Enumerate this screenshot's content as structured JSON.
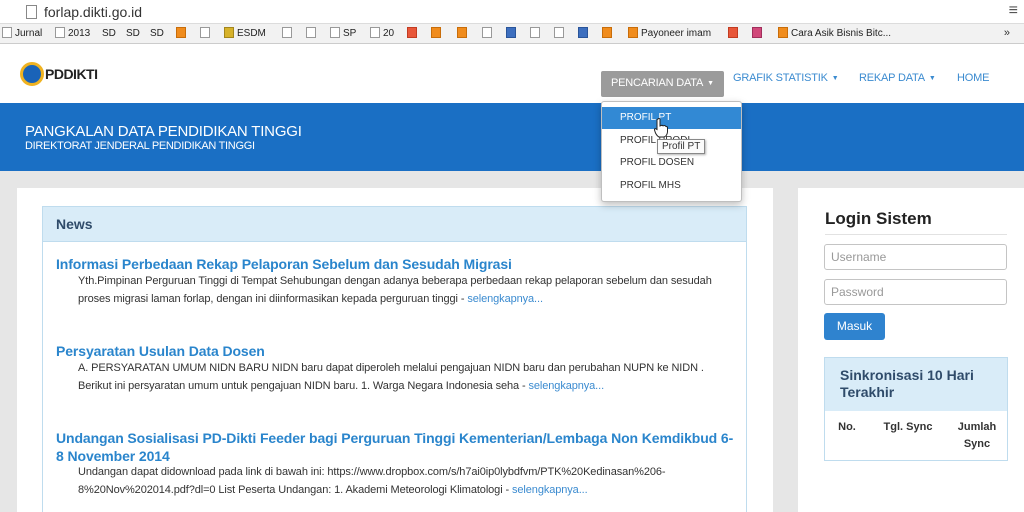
{
  "browser": {
    "url": "forlap.dikti.go.id",
    "bookmarks": [
      "Jurnal",
      "2013",
      "SD",
      "SD",
      "SD",
      "ESDM",
      "SP",
      "20",
      "Payoneer imam",
      "Cara Asik Bisnis Bitc..."
    ],
    "overflow": "»"
  },
  "site": {
    "logo_text": "PDDIKTI",
    "nav": [
      {
        "label": "PENCARIAN DATA"
      },
      {
        "label": "GRAFIK STATISTIK"
      },
      {
        "label": "REKAP DATA"
      },
      {
        "label": "HOME"
      }
    ],
    "dropdown": [
      "PROFIL PT",
      "PROFIL PRODI",
      "PROFIL DOSEN",
      "PROFIL MHS"
    ],
    "tooltip": "Profil PT",
    "banner_title": "PANGKALAN DATA PENDIDIKAN TINGGI",
    "banner_subtitle": "DIREKTORAT JENDERAL PENDIDIKAN TINGGI"
  },
  "news": {
    "heading": "News",
    "items": [
      {
        "title": "Informasi Perbedaan Rekap Pelaporan Sebelum dan Sesudah Migrasi",
        "body": "Yth.Pimpinan Perguruan Tinggi di Tempat Sehubungan dengan adanya beberapa perbedaan rekap pelaporan sebelum dan sesudah proses migrasi laman forlap, dengan ini diinformasikan kepada perguruan tinggi - ",
        "more": "selengkapnya..."
      },
      {
        "title": "Persyaratan Usulan Data Dosen",
        "body": "A. PERSYARATAN UMUM NIDN BARU NIDN baru dapat diperoleh melalui pengajuan NIDN baru dan perubahan NUPN ke NIDN . Berikut ini persyaratan umum untuk pengajuan NIDN baru. 1. Warga Negara Indonesia seha - ",
        "more": "selengkapnya..."
      },
      {
        "title": "Undangan Sosialisasi PD-Dikti Feeder bagi Perguruan Tinggi Kementerian/Lembaga Non Kemdikbud 6-8 November 2014",
        "body": "Undangan dapat didownload pada link di bawah ini: https://www.dropbox.com/s/h7ai0ip0lybdfvm/PTK%20Kedinasan%206-8%20Nov%202014.pdf?dl=0 List Peserta Undangan: 1. Akademi Meteorologi Klimatologi - ",
        "more": "selengkapnya..."
      }
    ]
  },
  "login": {
    "title": "Login Sistem",
    "username_placeholder": "Username",
    "password_placeholder": "Password",
    "button": "Masuk"
  },
  "sync": {
    "title": "Sinkronisasi 10 Hari Terakhir",
    "columns": [
      "No.",
      "Tgl. Sync",
      "Jumlah Sync"
    ]
  }
}
